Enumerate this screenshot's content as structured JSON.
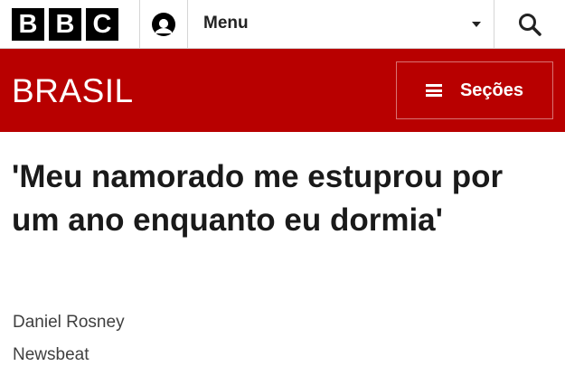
{
  "header": {
    "logo_letters": [
      "B",
      "B",
      "C"
    ],
    "menu_label": "Menu",
    "icons": {
      "account": "account-icon",
      "caret": "chevron-down-icon",
      "search": "search-icon"
    }
  },
  "brand": {
    "title": "BRASIL",
    "sections_label": "Seções",
    "accent_color": "#b80000"
  },
  "article": {
    "headline": "'Meu namorado me estuprou por um ano enquanto eu dormia'",
    "author": "Daniel Rosney",
    "outlet": "Newsbeat"
  }
}
